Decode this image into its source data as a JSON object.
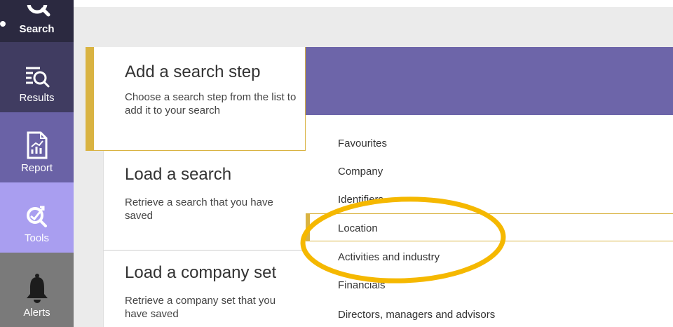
{
  "sidebar": {
    "items": [
      {
        "label": "Search",
        "icon": "search-icon"
      },
      {
        "label": "Results",
        "icon": "results-icon"
      },
      {
        "label": "Report",
        "icon": "report-icon"
      },
      {
        "label": "Tools",
        "icon": "tools-icon"
      },
      {
        "label": "Alerts",
        "icon": "bell-icon"
      }
    ]
  },
  "steps": {
    "add": {
      "title": "Add a search step",
      "desc": "Choose a search step from the list to add it to your search"
    },
    "load_search": {
      "title": "Load a search",
      "desc": "Retrieve a search that you have saved"
    },
    "load_company": {
      "title": "Load a company set",
      "desc": "Retrieve a company set that you have saved"
    }
  },
  "categories": [
    "Favourites",
    "Company",
    "Identifiers",
    "Location",
    "Activities and industry",
    "Financials",
    "Directors, managers and advisors"
  ],
  "colors": {
    "accent": "#d9b342",
    "annotation": "#f5b800",
    "band": "#6d65a9"
  }
}
